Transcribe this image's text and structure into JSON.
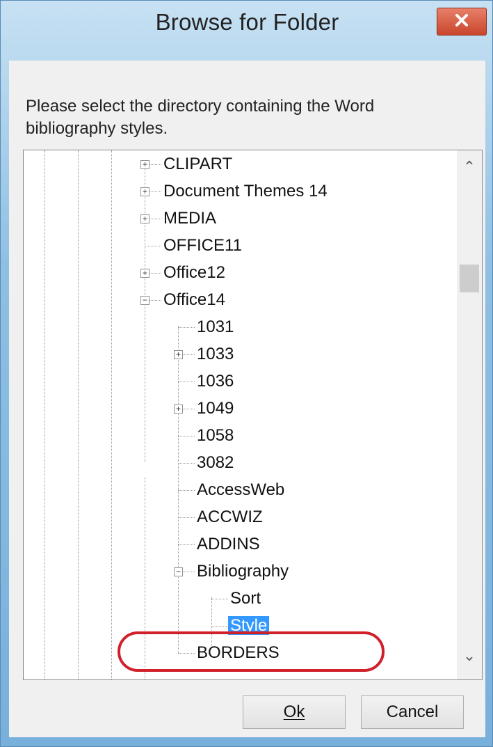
{
  "window": {
    "title": "Browse for Folder"
  },
  "dialog": {
    "prompt": "Please select the directory containing the Word bibliography styles.",
    "tree_items": [
      {
        "label": "CLIPART",
        "expander": "+"
      },
      {
        "label": "Document Themes 14",
        "expander": "+"
      },
      {
        "label": "MEDIA",
        "expander": "+"
      },
      {
        "label": "OFFICE11",
        "expander": ""
      },
      {
        "label": "Office12",
        "expander": "+"
      },
      {
        "label": "Office14",
        "expander": "−"
      },
      {
        "label": "1031",
        "expander": ""
      },
      {
        "label": "1033",
        "expander": "+"
      },
      {
        "label": "1036",
        "expander": ""
      },
      {
        "label": "1049",
        "expander": "+"
      },
      {
        "label": "1058",
        "expander": ""
      },
      {
        "label": "3082",
        "expander": ""
      },
      {
        "label": "AccessWeb",
        "expander": ""
      },
      {
        "label": "ACCWIZ",
        "expander": ""
      },
      {
        "label": "ADDINS",
        "expander": ""
      },
      {
        "label": "Bibliography",
        "expander": "−"
      },
      {
        "label": "Sort",
        "expander": ""
      },
      {
        "label": "Style",
        "expander": ""
      },
      {
        "label": "BORDERS",
        "expander": ""
      }
    ],
    "buttons": {
      "ok": "Ok",
      "cancel": "Cancel"
    }
  },
  "colors": {
    "selection": "#3399ff",
    "close": "#c9452c",
    "annotation": "#d0202a"
  },
  "icons": {
    "close": "close-icon",
    "scroll_up": "chevron-up-icon",
    "scroll_down": "chevron-down-icon"
  }
}
